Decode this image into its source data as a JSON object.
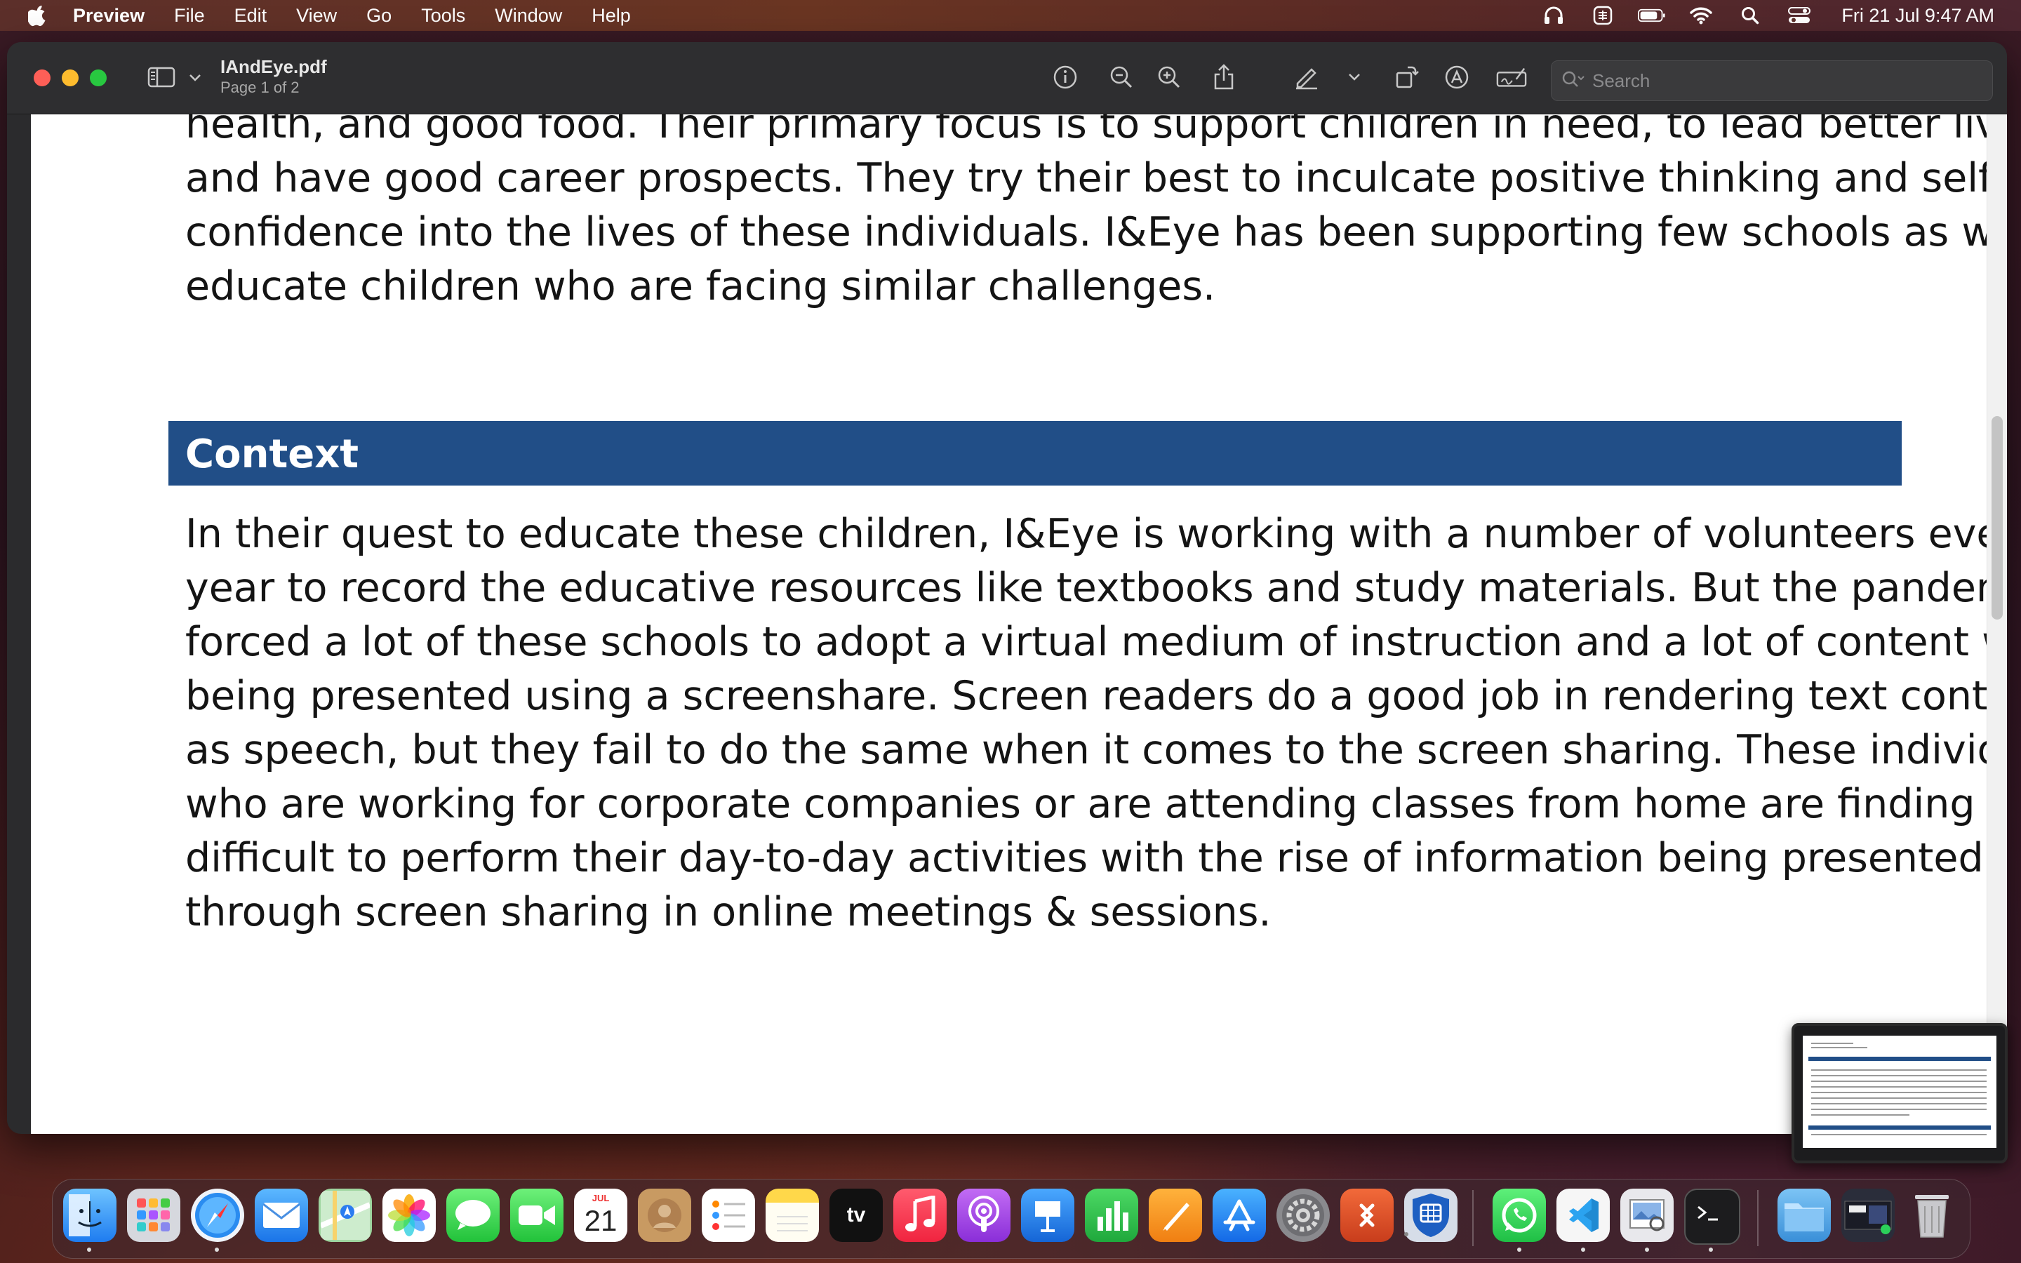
{
  "menubar": {
    "app_name": "Preview",
    "items": [
      "File",
      "Edit",
      "View",
      "Go",
      "Tools",
      "Window",
      "Help"
    ],
    "clock": "Fri 21 Jul  9:47 AM"
  },
  "window": {
    "title": "IAndEye.pdf",
    "subtitle": "Page 1 of 2",
    "search_placeholder": "Search"
  },
  "document": {
    "para1_lines": [
      "health, and good food. Their primary focus is to support children in need, to lead better lives",
      "and have good career prospects. They try their best to inculcate positive thinking and self-",
      "confidence into the lives of these individuals. I&Eye has been supporting few schools as well to",
      "educate children who are facing similar challenges."
    ],
    "section_heading": "Context",
    "para2_lines": [
      "In their quest to educate these children, I&Eye is working with a number of volunteers every",
      "year to record the educative resources like textbooks and study materials. But the pandemic",
      "forced a lot of these schools to adopt a virtual medium of instruction and a lot of content was",
      "being presented using a screenshare. Screen readers do a good job in rendering text content",
      "as speech, but they fail to do the same when it comes to the screen sharing. These individuals",
      "who are working for corporate companies or are attending classes from home are finding it",
      "difficult to perform their day-to-day activities with the rise of information being presented",
      "through screen sharing in online meetings & sessions."
    ],
    "heading_color": "#214e87"
  },
  "dock": {
    "calendar_month": "JUL",
    "calendar_day": "21",
    "tv_label": "tv",
    "apps": [
      "finder-icon",
      "launchpad-icon",
      "safari-icon",
      "mail-icon",
      "maps-icon",
      "photos-icon",
      "messages-icon",
      "facetime-icon",
      "calendar-icon",
      "contacts-icon",
      "reminders-icon",
      "notes-icon",
      "appletv-icon",
      "music-icon",
      "podcasts-icon",
      "keynote-icon",
      "numbers-icon",
      "pages-icon",
      "appstore-icon",
      "system-settings-icon",
      "remote-desktop-icon",
      "vpn-shield-icon",
      "whatsapp-icon",
      "vscode-icon",
      "preview-icon",
      "terminal-icon",
      "downloads-folder-icon",
      "recent-window-icon",
      "trash-icon"
    ]
  }
}
